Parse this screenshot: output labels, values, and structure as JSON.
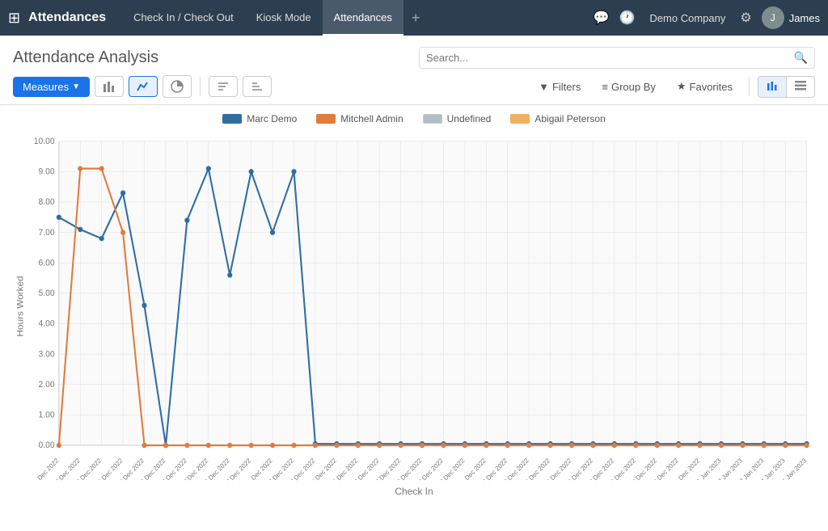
{
  "app": {
    "title": "Attendances",
    "nav_items": [
      {
        "label": "Check In / Check Out",
        "active": false
      },
      {
        "label": "Kiosk Mode",
        "active": false
      },
      {
        "label": "Attendances",
        "active": true
      }
    ],
    "company": "Demo Company",
    "username": "James"
  },
  "header": {
    "page_title": "Attendance Analysis",
    "search_placeholder": "Search..."
  },
  "toolbar": {
    "measures_label": "Measures",
    "chart_types": [
      {
        "icon": "▦",
        "label": "Bar Chart",
        "active": false
      },
      {
        "icon": "◼",
        "label": "Line Chart",
        "active": true
      },
      {
        "icon": "◕",
        "label": "Pie Chart",
        "active": false
      }
    ],
    "sort_btns": [
      {
        "icon": "⇅",
        "label": "Ascending"
      },
      {
        "icon": "⇵",
        "label": "Descending"
      }
    ],
    "filters_label": "Filters",
    "groupby_label": "Group By",
    "favorites_label": "Favorites",
    "view_toggle": [
      {
        "icon": "▦",
        "label": "Graph View",
        "active": true
      },
      {
        "icon": "☰",
        "label": "List View",
        "active": false
      }
    ]
  },
  "chart": {
    "y_axis_label": "Hours Worked",
    "x_axis_label": "Check In",
    "legend": [
      {
        "label": "Marc Demo",
        "color": "#2e6da4"
      },
      {
        "label": "Mitchell Admin",
        "color": "#e07c3d"
      },
      {
        "label": "Undefined",
        "color": "#b0bec5"
      },
      {
        "label": "Abigail Peterson",
        "color": "#f0b060"
      }
    ],
    "y_ticks": [
      "0.00",
      "1.00",
      "2.00",
      "3.00",
      "4.00",
      "5.00",
      "6.00",
      "7.00",
      "8.00",
      "9.00",
      "10.00"
    ],
    "x_labels": [
      "01 Dec 2022",
      "02 Dec 2022",
      "03 Dec 2022",
      "04 Dec 2022",
      "05 Dec 2022",
      "06 Dec 2022",
      "07 Dec 2022",
      "08 Dec 2022",
      "09 Dec 2022",
      "10 Dec 2022",
      "11 Dec 2022",
      "12 Dec 2022",
      "13 Dec 2022",
      "14 Dec 2022",
      "15 Dec 2022",
      "16 Dec 2022",
      "17 Dec 2022",
      "18 Dec 2022",
      "19 Dec 2022",
      "20 Dec 2022",
      "21 Dec 2022",
      "22 Dec 2022",
      "23 Dec 2022",
      "24 Dec 2022",
      "25 Dec 2022",
      "26 Dec 2022",
      "27 Dec 2022",
      "28 Dec 2022",
      "29 Dec 2022",
      "30 Dec 2022",
      "31 Dec 2022",
      "01 Jan 2023",
      "02 Jan 2023",
      "03 Jan 2023",
      "04 Jan 2023",
      "05 Jan 2023"
    ],
    "series": {
      "marc_demo": {
        "color": "#2e6da4",
        "points": [
          7.5,
          7.1,
          6.8,
          8.3,
          4.6,
          0,
          7.4,
          9.1,
          5.6,
          9.0,
          7.0,
          9.0,
          0.05,
          0.05,
          0.05,
          0.05,
          0.05,
          0.05,
          0.05,
          0.05,
          0.05,
          0.05,
          0.05,
          0.05,
          0.05,
          0.05,
          0.05,
          0.05,
          0.05,
          0.05,
          0.05,
          0.05,
          0.05,
          0.05,
          0.05,
          0.05
        ]
      },
      "mitchell_admin": {
        "color": "#e07c3d",
        "points": [
          0,
          9.1,
          9.1,
          7.0,
          0,
          0,
          0,
          0,
          0,
          0,
          0,
          0,
          0,
          0,
          0,
          0,
          0,
          0,
          0,
          0,
          0,
          0,
          0,
          0,
          0,
          0,
          0,
          0,
          0,
          0,
          0,
          0,
          0,
          0,
          0,
          0
        ]
      },
      "abigail_peterson": {
        "color": "#f0b060",
        "points": [
          0,
          0,
          0,
          0,
          0,
          0,
          0,
          0,
          0,
          0,
          0,
          0,
          0,
          0,
          0,
          0,
          0,
          0,
          0,
          0,
          0,
          0,
          0,
          0,
          0,
          0,
          0,
          0,
          0,
          0,
          0,
          0,
          0,
          0,
          0,
          0
        ]
      }
    }
  }
}
